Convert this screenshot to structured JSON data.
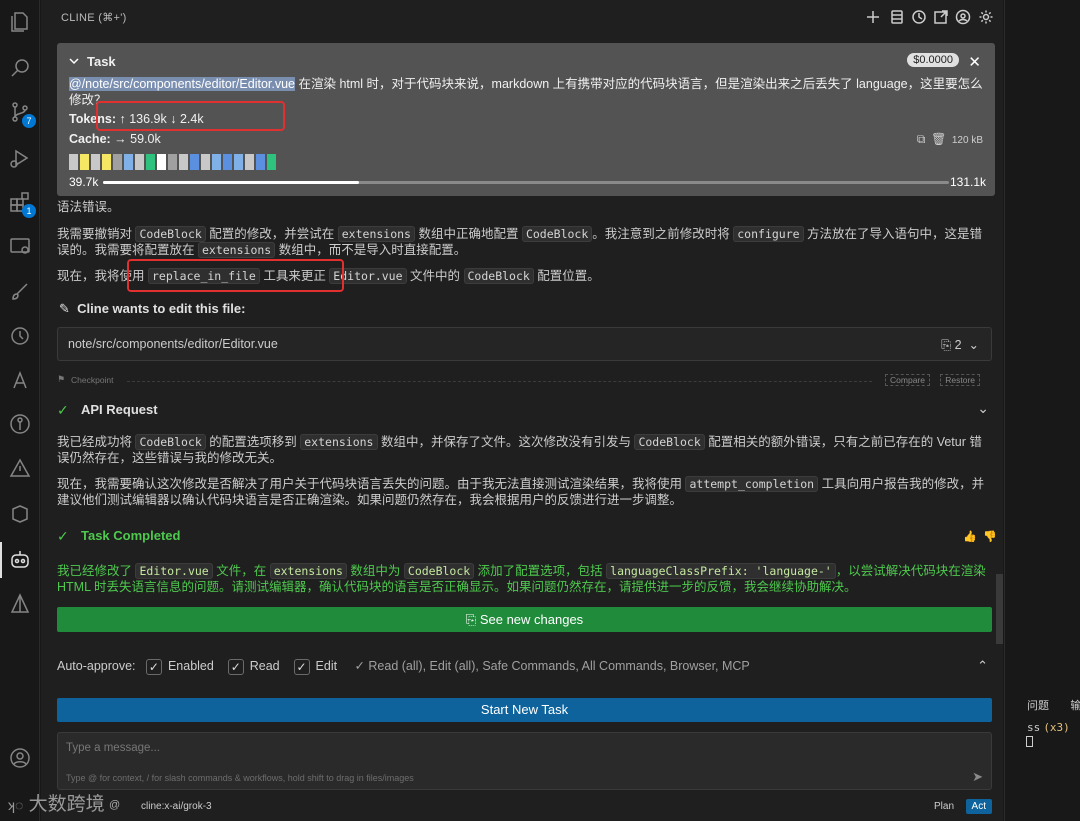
{
  "header": {
    "title": "CLINE (⌘+')",
    "icons": [
      "plus-icon",
      "database-icon",
      "history-icon",
      "popout-icon",
      "account-icon",
      "gear-icon"
    ]
  },
  "activity_bar": {
    "icons": [
      "files-icon",
      "search-icon",
      "source-control-icon",
      "run-debug-icon",
      "extensions-icon",
      "remote-explorer-icon",
      "brush-icon",
      "timeline-icon",
      "testing-icon",
      "git-graph-icon",
      "warning-icon",
      "plugin-icon",
      "cline-robot-icon",
      "prism-icon",
      "account-icon",
      "settings-icon"
    ],
    "source_control_badge": "7",
    "extensions_badge": "1"
  },
  "task": {
    "title": "Task",
    "cost": "$0.0000",
    "mention": "@/note/src/components/editor/Editor.vue",
    "text": " 在渲染 html 时，对于代码块来说，markdown 上有携带对应的代码块语言，但是渲染出来之后丢失了 language，这里要怎么修改？",
    "tokens_label": "Tokens:",
    "tokens_up": "↑ 136.9k",
    "tokens_down": "↓ 2.4k",
    "cache_label": "Cache:",
    "cache_value": "→ 59.0k",
    "size": "120 kB",
    "context_used": "39.7k",
    "context_total": "131.1k",
    "context_fraction": 0.303,
    "blocks": [
      "#c8c8c8",
      "#f5e663",
      "#c8c8c8",
      "#f5e663",
      "#a0a0a0",
      "#7fb0e8",
      "#c8c8c8",
      "#2ec27e",
      "#ffffff",
      "#a0a0a0",
      "#c8c8c8",
      "#5b8fe0",
      "#c8c8c8",
      "#7fb0e8",
      "#5b8fe0",
      "#7fb0e8",
      "#c8c8c8",
      "#5b8fe0",
      "#2ec27e"
    ]
  },
  "chat": {
    "cut_line": "语法错误。",
    "p1_a": "我需要撤销对 ",
    "p1_code1": "CodeBlock",
    "p1_b": " 配置的修改，并尝试在 ",
    "p1_code2": "extensions",
    "p1_c": " 数组中正确地配置 ",
    "p1_code3": "CodeBlock",
    "p1_d": "。我注意到之前修改时将 ",
    "p1_code4": "configure",
    "p1_e": " 方法放在了导入语句中，这是错误的。我需要将配置放在 ",
    "p1_code5": "extensions",
    "p1_f": " 数组中，而不是导入时直接配置。",
    "p2_a": "现在，我将使用 ",
    "p2_code1": "replace_in_file",
    "p2_b": " 工具来更正 ",
    "p2_code2": "Editor.vue",
    "p2_c": " 文件中的 ",
    "p2_code3": "CodeBlock",
    "p2_d": " 配置位置。",
    "edit_title": "Cline wants to edit this file:",
    "file_path": "note/src/components/editor/Editor.vue",
    "file_count": "2",
    "checkpoint": "Checkpoint",
    "compare": "Compare",
    "restore": "Restore",
    "api_title": "API Request",
    "p3_a": "我已经成功将 ",
    "p3_code1": "CodeBlock",
    "p3_b": " 的配置选项移到 ",
    "p3_code2": "extensions",
    "p3_c": " 数组中，并保存了文件。这次修改没有引发与 ",
    "p3_code3": "CodeBlock",
    "p3_d": " 配置相关的额外错误，只有之前已存在的 Vetur 错误仍然存在，这些错误与我的修改无关。",
    "p4_a": "现在，我需要确认这次修改是否解决了用户关于代码块语言丢失的问题。由于我无法直接测试渲染结果，我将使用 ",
    "p4_code1": "attempt_completion",
    "p4_b": " 工具向用户报告我的修改，并建议他们测试编辑器以确认代码块语言是否正确渲染。如果问题仍然存在，我会根据用户的反馈进行进一步调整。",
    "completed_title": "Task Completed",
    "p5_a": "我已经修改了 ",
    "p5_code1": "Editor.vue",
    "p5_b": " 文件，在 ",
    "p5_code2": "extensions",
    "p5_c": " 数组中为 ",
    "p5_code3": "CodeBlock",
    "p5_d": " 添加了配置选项，包括 ",
    "p5_code4": "languageClassPrefix: 'language-'",
    "p5_e": "，以尝试解决代码块在渲染 HTML 时丢失语言信息的问题。请测试编辑器，确认代码块的语言是否正确显示。如果问题仍然存在，请提供进一步的反馈，我会继续协助解决。",
    "see_changes": "See new changes"
  },
  "auto_approve": {
    "label": "Auto-approve:",
    "enabled": "Enabled",
    "read": "Read",
    "edit": "Edit",
    "summary": "✓ Read (all), Edit (all), Safe Commands, All Commands, Browser, MCP"
  },
  "start_new_task": "Start New Task",
  "input": {
    "placeholder": "Type a message...",
    "hint": "Type @ for context, / for slash commands & workflows, hold shift to drag in files/images"
  },
  "footer": {
    "model": "cline:x-ai/grok-3",
    "plan": "Plan",
    "act": "Act"
  },
  "watermark": "大数跨境",
  "right_panel": {
    "tab1": "问题",
    "tab2": "输",
    "terminal_line": "ss",
    "terminal_count": "(x3)"
  }
}
